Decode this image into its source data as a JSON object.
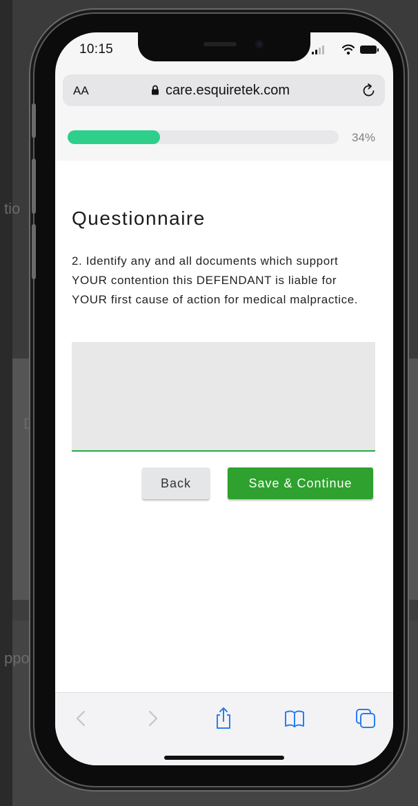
{
  "background": {
    "left_fragment_1": "tio",
    "left_fragment_2": "D",
    "left_fragment_3": "ppo"
  },
  "status_bar": {
    "time": "10:15",
    "signal_icon": "signal-icon",
    "wifi_icon": "wifi-icon",
    "battery_icon": "battery-icon"
  },
  "browser": {
    "text_size_label": "AA",
    "url": "care.esquiretek.com",
    "lock_icon": "lock-icon",
    "reload_icon": "reload-icon"
  },
  "progress": {
    "percent_label": "34%",
    "value": 0.34
  },
  "form": {
    "title": "Questionnaire",
    "question": "2. Identify any and all documents which support YOUR contention this DEFENDANT is liable for YOUR first cause of action for medical malpractice.",
    "answer_value": "",
    "back_label": "Back",
    "save_label": "Save & Continue"
  },
  "toolbar": {
    "back_icon": "chevron-left-icon",
    "forward_icon": "chevron-right-icon",
    "share_icon": "share-icon",
    "bookmarks_icon": "book-icon",
    "tabs_icon": "tabs-icon"
  },
  "colors": {
    "progress_fill": "#2ecf8a",
    "primary_button": "#2ea12e",
    "input_underline": "#28a745",
    "toolbar_icon": "#2a7cf0"
  }
}
